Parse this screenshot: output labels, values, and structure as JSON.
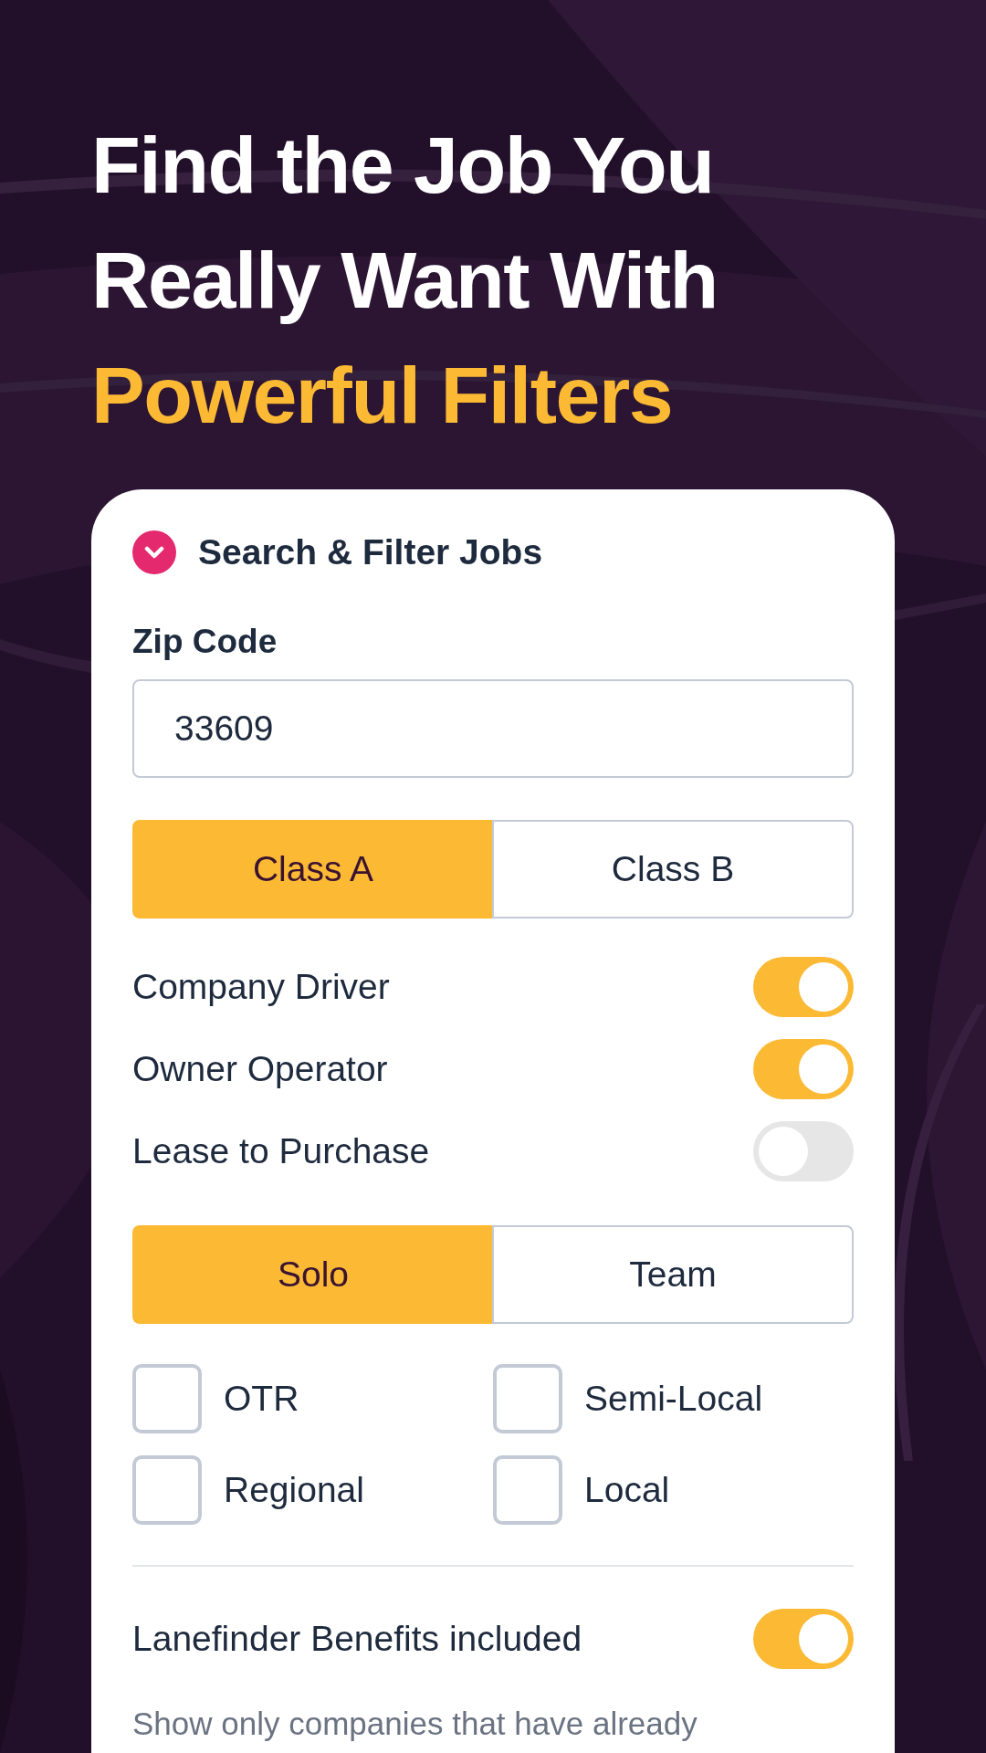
{
  "headline": {
    "lines": [
      "Find the Job You",
      "Really Want With"
    ],
    "highlight": "Powerful Filters"
  },
  "panel": {
    "title": "Search & Filter Jobs",
    "expanded": true,
    "zip": {
      "label": "Zip Code",
      "value": "33609"
    },
    "license_class": [
      {
        "label": "Class A",
        "selected": true
      },
      {
        "label": "Class B",
        "selected": false
      }
    ],
    "driver_types": [
      {
        "label": "Company Driver",
        "on": true
      },
      {
        "label": "Owner Operator",
        "on": true
      },
      {
        "label": "Lease to Purchase",
        "on": false
      }
    ],
    "team_type": [
      {
        "label": "Solo",
        "selected": true
      },
      {
        "label": "Team",
        "selected": false
      }
    ],
    "route_types": [
      {
        "label": "OTR",
        "checked": false
      },
      {
        "label": "Semi-Local",
        "checked": false
      },
      {
        "label": "Regional",
        "checked": false
      },
      {
        "label": "Local",
        "checked": false
      }
    ],
    "benefits": {
      "label": "Lanefinder Benefits included",
      "on": true,
      "description": "Show only companies that have already"
    }
  }
}
